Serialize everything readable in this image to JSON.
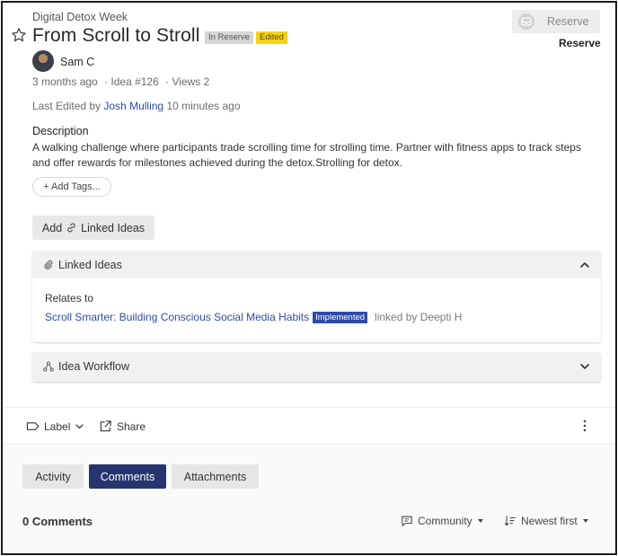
{
  "idea": {
    "category": "Digital Detox Week",
    "title": "From Scroll to Stroll",
    "badges": {
      "reserve": "In Reserve",
      "edited": "Edited"
    },
    "reserve_button": "Reserve",
    "reserve_caption": "Reserve",
    "author": "Sam C",
    "posted": "3 months ago",
    "idea_number": "· Idea #126",
    "views": "· Views 2",
    "last_edited_prefix": "Last Edited by",
    "last_edited_by": "Josh Mulling",
    "last_edited_when": "10 minutes ago",
    "description_heading": "Description",
    "description": "A walking challenge where participants trade scrolling time for strolling time. Partner with fitness apps to track steps and offer rewards for milestones achieved during the detox.Strolling for detox.",
    "add_tags": "+ Add Tags...",
    "add_linked": {
      "prefix": "Add",
      "suffix": "Linked Ideas"
    }
  },
  "linked_ideas": {
    "title": "Linked Ideas",
    "relates_to": "Relates to",
    "items": [
      {
        "title": "Scroll Smarter: Building Conscious Social Media Habits",
        "status": "Implemented",
        "linked_by": "linked by Deepti H"
      }
    ]
  },
  "workflow": {
    "title": "Idea Workflow"
  },
  "actions": {
    "label": "Label",
    "share": "Share"
  },
  "tabs": [
    {
      "label": "Activity",
      "active": false
    },
    {
      "label": "Comments",
      "active": true
    },
    {
      "label": "Attachments",
      "active": false
    }
  ],
  "comments": {
    "count_label": "0 Comments",
    "filter": "Community",
    "sort": "Newest first"
  },
  "colors": {
    "accent": "#2f4ba8",
    "active_tab": "#263570",
    "edited_badge": "#f2d21a",
    "reserve_badge": "#d6d6d6"
  }
}
